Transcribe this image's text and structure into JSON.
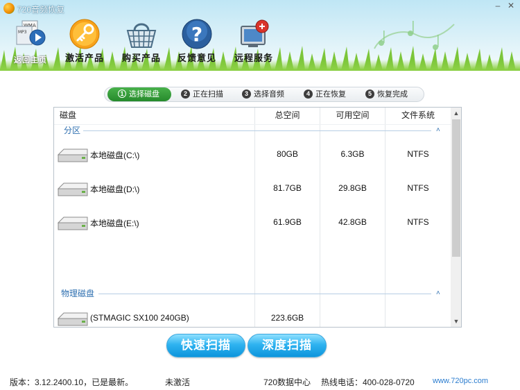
{
  "window": {
    "title": "720音频恢复",
    "minimize_glyph": "–",
    "close_glyph": "✕"
  },
  "nav": {
    "items": [
      {
        "label": "返回主页",
        "icon": "audio-files-icon"
      },
      {
        "label": "激活产品",
        "icon": "key-icon"
      },
      {
        "label": "购买产品",
        "icon": "shopping-basket-icon"
      },
      {
        "label": "反馈意见",
        "icon": "help-question-icon"
      },
      {
        "label": "远程服务",
        "icon": "remote-computer-icon"
      }
    ]
  },
  "steps": [
    {
      "num": "1",
      "label": "选择磁盘",
      "active": true
    },
    {
      "num": "2",
      "label": "正在扫描",
      "active": false
    },
    {
      "num": "3",
      "label": "选择音频",
      "active": false
    },
    {
      "num": "4",
      "label": "正在恢复",
      "active": false
    },
    {
      "num": "5",
      "label": "恢复完成",
      "active": false
    }
  ],
  "table": {
    "columns": [
      "磁盘",
      "总空间",
      "可用空间",
      "文件系统"
    ],
    "groups": [
      {
        "label": "分区",
        "toggle": "˄",
        "rows": [
          {
            "name": "本地磁盘(C:\\)",
            "total": "80GB",
            "free": "6.3GB",
            "fs": "NTFS"
          },
          {
            "name": "本地磁盘(D:\\)",
            "total": "81.7GB",
            "free": "29.8GB",
            "fs": "NTFS"
          },
          {
            "name": "本地磁盘(E:\\)",
            "total": "61.9GB",
            "free": "42.8GB",
            "fs": "NTFS"
          }
        ]
      },
      {
        "label": "物理磁盘",
        "toggle": "˄",
        "rows": [
          {
            "name": "(STMAGIC SX100 240GB)",
            "total": "223.6GB",
            "free": "",
            "fs": ""
          }
        ]
      }
    ],
    "scroll_up": "▲",
    "scroll_down": "▼"
  },
  "actions": {
    "quick_scan": "快速扫描",
    "deep_scan": "深度扫描"
  },
  "status": {
    "version": "版本：3.12.2400.10，已是最新。",
    "activation": "未激活",
    "center": "720数据中心",
    "hotline": "热线电话：400-028-0720",
    "website": "www.720pc.com"
  },
  "colors": {
    "active_step": "#2f9a33",
    "group_label": "#2e6fb0",
    "button_blue": "#1ea5e8",
    "website_link": "#2a7ccf"
  }
}
